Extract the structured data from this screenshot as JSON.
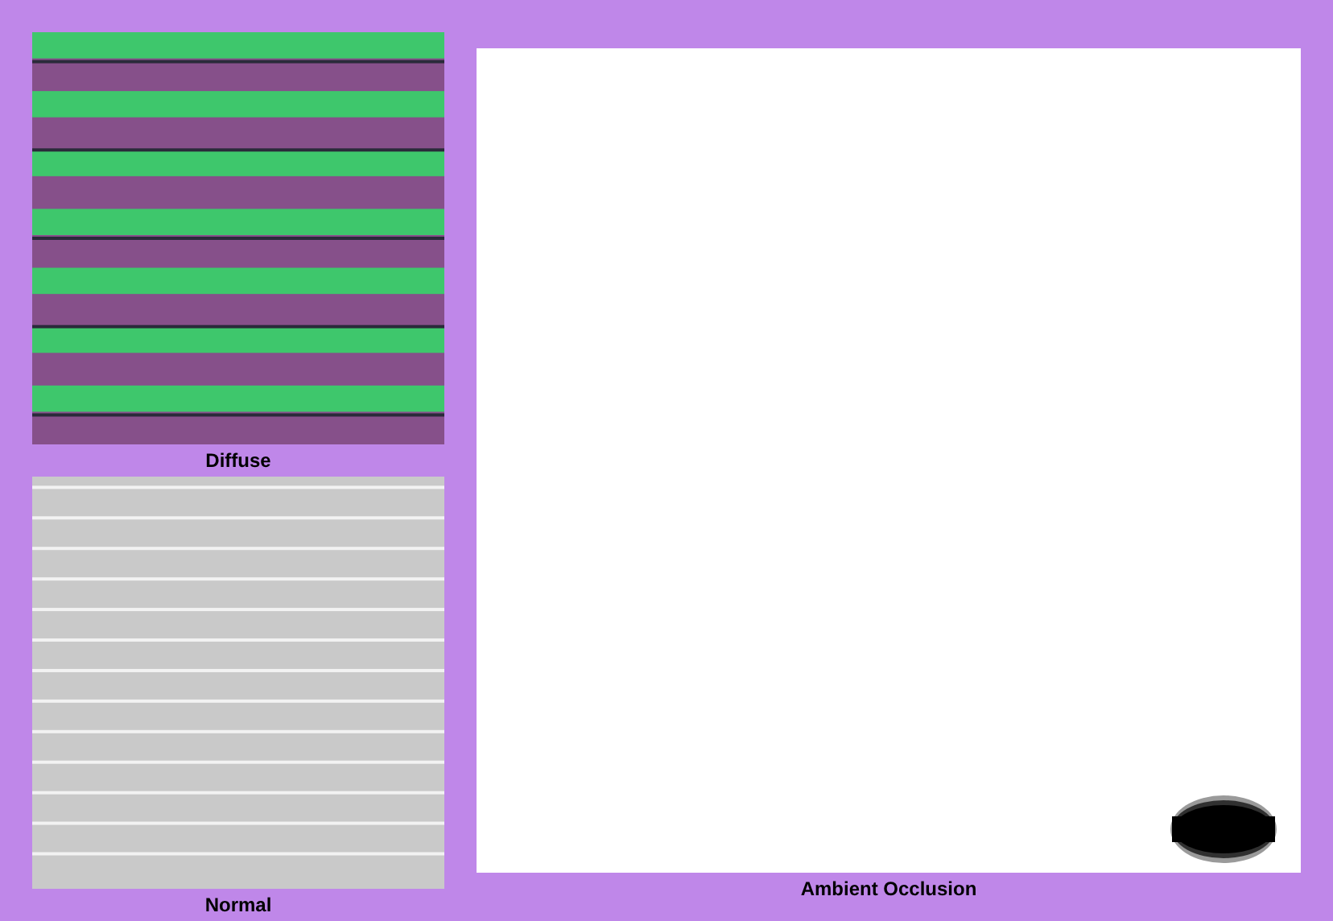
{
  "maps": [
    {
      "label": "Diffuse",
      "kind": "diffuse"
    },
    {
      "label": "Normal",
      "kind": "normal"
    },
    {
      "label": "Ambient Occlusion",
      "kind": "occlusion"
    }
  ]
}
